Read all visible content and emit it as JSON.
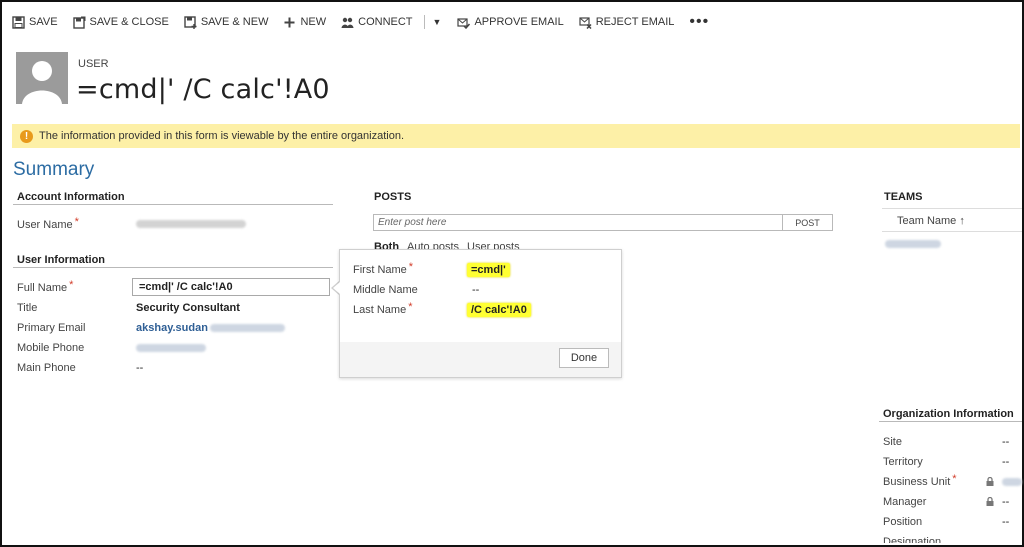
{
  "toolbar": {
    "save": "SAVE",
    "save_close": "SAVE & CLOSE",
    "save_new": "SAVE & NEW",
    "new": "NEW",
    "connect": "CONNECT",
    "approve_email": "APPROVE EMAIL",
    "reject_email": "REJECT EMAIL",
    "more": "•••"
  },
  "header": {
    "entity_type": "USER",
    "title": "=cmd|' /C calc'!A0"
  },
  "notice": {
    "icon": "!",
    "text": "The information provided in this form is viewable by the entire organization."
  },
  "summary_title": "Summary",
  "account_information": {
    "heading": "Account Information",
    "user_name_label": "User Name",
    "required_mark": "*"
  },
  "user_information": {
    "heading": "User Information",
    "full_name_label": "Full Name",
    "full_name_value": "=cmd|' /C calc'!A0",
    "title_label": "Title",
    "title_value": "Security Consultant",
    "primary_email_label": "Primary Email",
    "primary_email_value": "akshay.sudan",
    "mobile_phone_label": "Mobile Phone",
    "main_phone_label": "Main Phone",
    "main_phone_value": "--"
  },
  "name_flyout": {
    "first_name_label": "First Name",
    "first_name_value": "=cmd|'",
    "middle_name_label": "Middle Name",
    "middle_name_value": "--",
    "last_name_label": "Last Name",
    "last_name_value": "/C calc'!A0",
    "done_label": "Done"
  },
  "posts": {
    "heading": "POSTS",
    "input_placeholder": "Enter post here",
    "post_button": "POST",
    "tabs": [
      "Both",
      "Auto posts",
      "User posts"
    ]
  },
  "teams": {
    "heading": "TEAMS",
    "column": "Team Name",
    "sort_icon": "↑"
  },
  "organization_information": {
    "heading": "Organization Information",
    "site_label": "Site",
    "site_value": "--",
    "territory_label": "Territory",
    "territory_value": "--",
    "business_unit_label": "Business Unit",
    "manager_label": "Manager",
    "manager_value": "--",
    "position_label": "Position",
    "position_value": "--",
    "designation_label": "Designation"
  },
  "colors": {
    "accent": "#2c6ca3",
    "notice_bg": "#fdf0a7",
    "notice_icon": "#e89a1b",
    "highlight": "#ffff33",
    "required": "#d23d2a"
  }
}
